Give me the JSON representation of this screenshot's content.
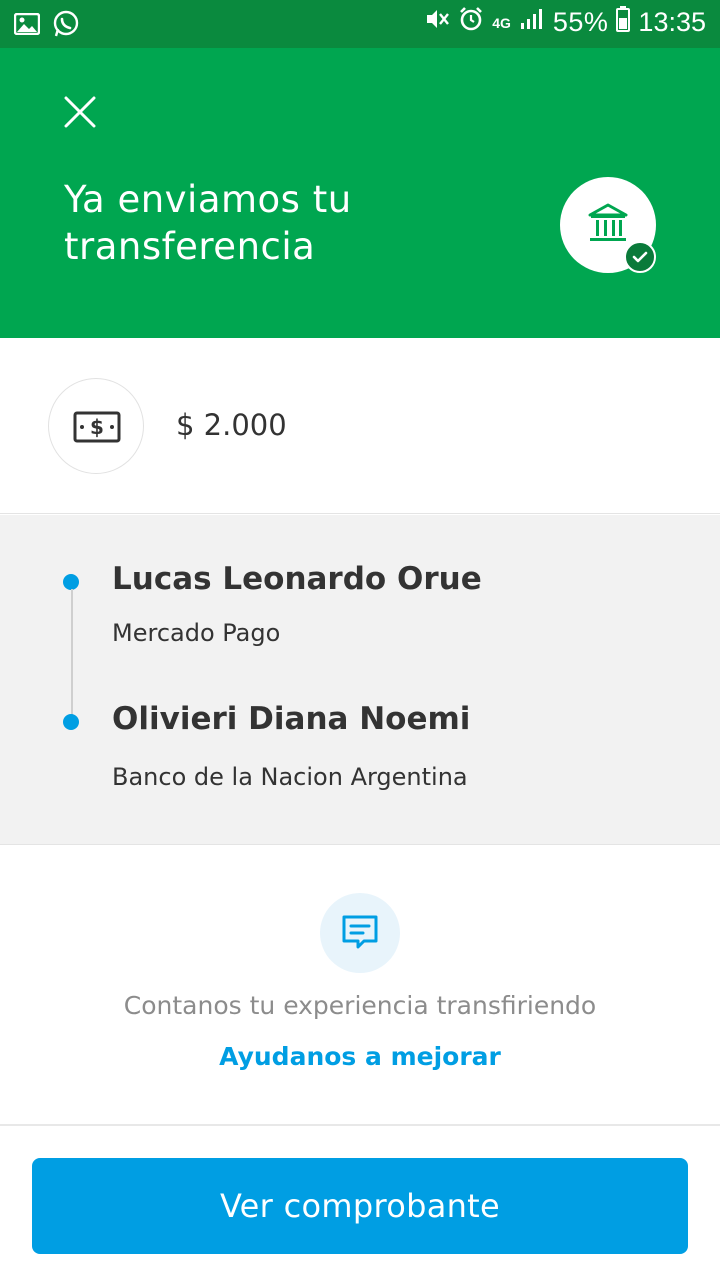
{
  "status_bar": {
    "icons_left": [
      "image-icon",
      "whatsapp-icon"
    ],
    "icons_right": [
      "mute-vibrate-icon",
      "alarm-icon",
      "4g-icon",
      "signal-icon",
      "battery-icon"
    ],
    "battery_percent": "55%",
    "time": "13:35"
  },
  "header": {
    "title": "Ya enviamos tu transferencia",
    "close_icon": "close-icon",
    "badge_icon": "bank-icon",
    "badge_check_icon": "check-icon",
    "background_color": "#00a650"
  },
  "amount": {
    "icon": "money-bill-icon",
    "value": "$ 2.000"
  },
  "parties": {
    "sender": {
      "name": "Lucas Leonardo Orue",
      "bank": "Mercado Pago"
    },
    "recipient": {
      "name": "Olivieri Diana Noemi",
      "bank": "Banco de la Nacion Argentina"
    },
    "accent_color": "#009ee3"
  },
  "feedback": {
    "icon": "message-icon",
    "text": "Contanos tu experiencia transfiriendo",
    "link": "Ayudanos a mejorar"
  },
  "actions": {
    "primary_label": "Ver comprobante",
    "primary_color": "#009ee3"
  }
}
